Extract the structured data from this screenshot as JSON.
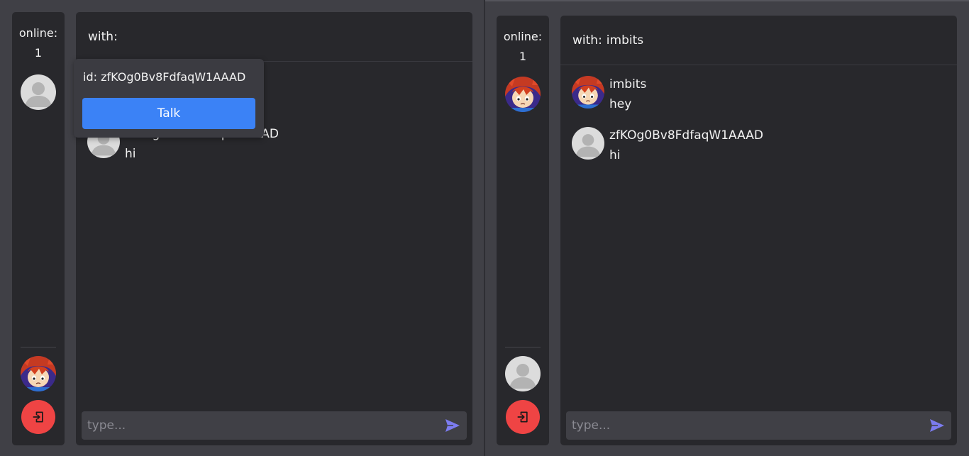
{
  "left": {
    "sidebar": {
      "online_label": "online:",
      "online_count": "1"
    },
    "chat": {
      "header_label": "with:",
      "header_user": "",
      "messages": [
        {
          "name": "zfKOg0Bv8FdfaqW1AAAD",
          "text": "hi"
        }
      ],
      "input_placeholder": "type..."
    },
    "popover": {
      "id_text": "id: zfKOg0Bv8FdfaqW1AAAD",
      "talk_label": "Talk"
    }
  },
  "right": {
    "sidebar": {
      "online_label": "online:",
      "online_count": "1"
    },
    "chat": {
      "header_label": "with:",
      "header_user": "imbits",
      "messages": [
        {
          "name": "imbits",
          "text": "hey"
        },
        {
          "name": "zfKOg0Bv8FdfaqW1AAAD",
          "text": "hi"
        }
      ],
      "input_placeholder": "type..."
    }
  },
  "icons": {
    "default_avatar": "default-avatar-icon",
    "anime_avatar": "anime-avatar-icon",
    "logout": "logout-icon",
    "send": "send-icon"
  },
  "colors": {
    "accent_blue": "#3b82f6",
    "logout_red": "#ef4444",
    "send_purple": "#7c7cf0",
    "panel": "#28282c",
    "background": "#404046"
  }
}
